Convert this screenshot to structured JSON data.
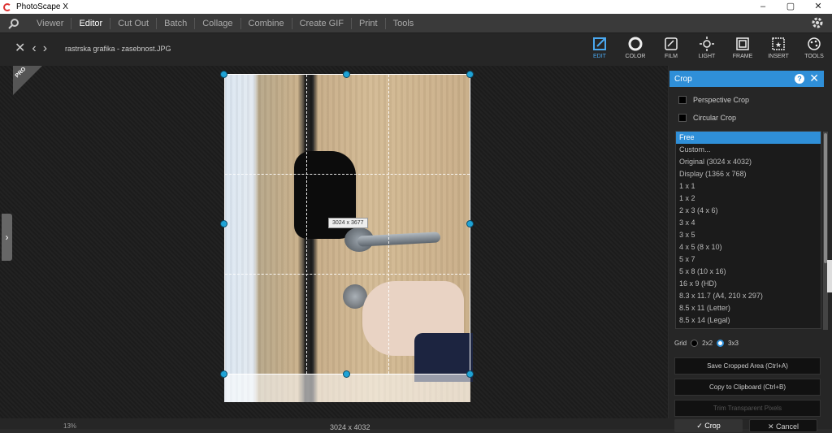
{
  "app": {
    "title": "PhotoScape X"
  },
  "window_controls": {
    "minimize": "–",
    "restore": "▢",
    "close": "✕"
  },
  "menu": [
    "Viewer",
    "Editor",
    "Cut Out",
    "Batch",
    "Collage",
    "Combine",
    "Create GIF",
    "Print",
    "Tools"
  ],
  "menu_active": "Editor",
  "file": {
    "name": "rastrska grafika - zasebnost.JPG"
  },
  "tools": [
    {
      "label": "EDIT",
      "icon": "edit-icon",
      "active": true
    },
    {
      "label": "COLOR",
      "icon": "color-icon"
    },
    {
      "label": "FILM",
      "icon": "film-icon"
    },
    {
      "label": "LIGHT",
      "icon": "light-icon"
    },
    {
      "label": "FRAME",
      "icon": "frame-icon"
    },
    {
      "label": "INSERT",
      "icon": "insert-icon"
    },
    {
      "label": "TOOLS",
      "icon": "tools-icon"
    }
  ],
  "badge": {
    "text": "PRO"
  },
  "crop_tip": "3024 x 3677",
  "panel": {
    "title": "Crop",
    "perspective_crop": "Perspective Crop",
    "circular_crop": "Circular Crop",
    "ratios": [
      "Free",
      "Custom...",
      "Original (3024 x 4032)",
      "Display (1366 x 768)",
      "1 x 1",
      "1 x 2",
      "2 x 3 (4 x 6)",
      "3 x 4",
      "3 x 5",
      "4 x 5 (8 x 10)",
      "5 x 7",
      "5 x 8 (10 x 16)",
      "16 x 9 (HD)",
      "8.3 x 11.7 (A4, 210 x 297)",
      "8.5 x 11 (Letter)",
      "8.5 x 14 (Legal)"
    ],
    "selected_ratio": "Free",
    "grid_label": "Grid",
    "grid_2": "2x2",
    "grid_3": "3x3",
    "grid_selected": "3x3",
    "save_cropped": "Save Cropped Area (Ctrl+A)",
    "copy_clipboard": "Copy to Clipboard (Ctrl+B)",
    "trim": "Trim Transparent Pixels",
    "crop_button": "✓ Crop",
    "cancel_button": "✕ Cancel"
  },
  "status": {
    "zoom": "13%",
    "dimensions": "3024 x 4032"
  }
}
